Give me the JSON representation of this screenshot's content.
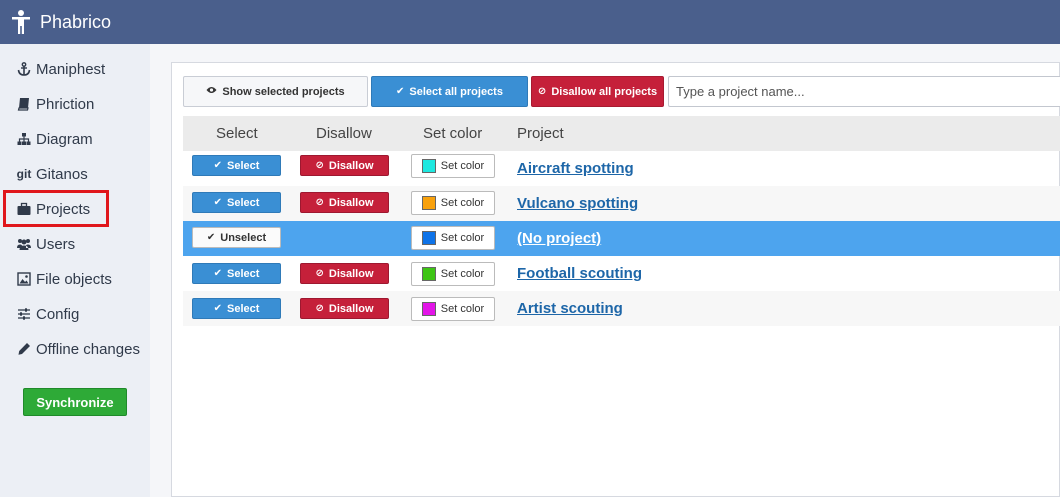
{
  "app": {
    "title": "Phabrico"
  },
  "sidebar": {
    "items": [
      {
        "label": "Maniphest",
        "icon": "anchor-icon"
      },
      {
        "label": "Phriction",
        "icon": "book-icon"
      },
      {
        "label": "Diagram",
        "icon": "sitemap-icon"
      },
      {
        "label": "Gitanos",
        "icon": "git-icon",
        "icon_text": "git"
      },
      {
        "label": "Projects",
        "icon": "briefcase-icon"
      },
      {
        "label": "Users",
        "icon": "users-icon"
      },
      {
        "label": "File objects",
        "icon": "image-icon"
      },
      {
        "label": "Config",
        "icon": "sliders-icon"
      },
      {
        "label": "Offline changes",
        "icon": "pencil-icon"
      }
    ],
    "sync_label": "Synchronize"
  },
  "toolbar": {
    "show_selected_label": "Show selected projects",
    "select_all_label": "Select all projects",
    "disallow_all_label": "Disallow all projects",
    "search_placeholder": "Type a project name..."
  },
  "table": {
    "columns": [
      "Select",
      "Disallow",
      "Set color",
      "Project"
    ],
    "rows": [
      {
        "select_label": "Select",
        "disallow_label": "Disallow",
        "color_label": "Set color",
        "color": "#1ee8e0",
        "project": "Aircraft spotting"
      },
      {
        "select_label": "Select",
        "disallow_label": "Disallow",
        "color_label": "Set color",
        "color": "#f8a10d",
        "project": "Vulcano spotting"
      },
      {
        "select_label": "Unselect",
        "disallow_label": "",
        "color_label": "Set color",
        "color": "#0e73e8",
        "project": "(No project)"
      },
      {
        "select_label": "Select",
        "disallow_label": "Disallow",
        "color_label": "Set color",
        "color": "#3dc414",
        "project": "Football scouting"
      },
      {
        "select_label": "Select",
        "disallow_label": "Disallow",
        "color_label": "Set color",
        "color": "#e315e8",
        "project": "Artist scouting"
      }
    ]
  },
  "colors": {
    "topbar": "#4a5f8c",
    "accent_blue": "#3a8fd4",
    "danger_red": "#c5203a",
    "success_green": "#2eaa37",
    "row_selected": "#4da4ee",
    "link": "#1d66a8"
  }
}
